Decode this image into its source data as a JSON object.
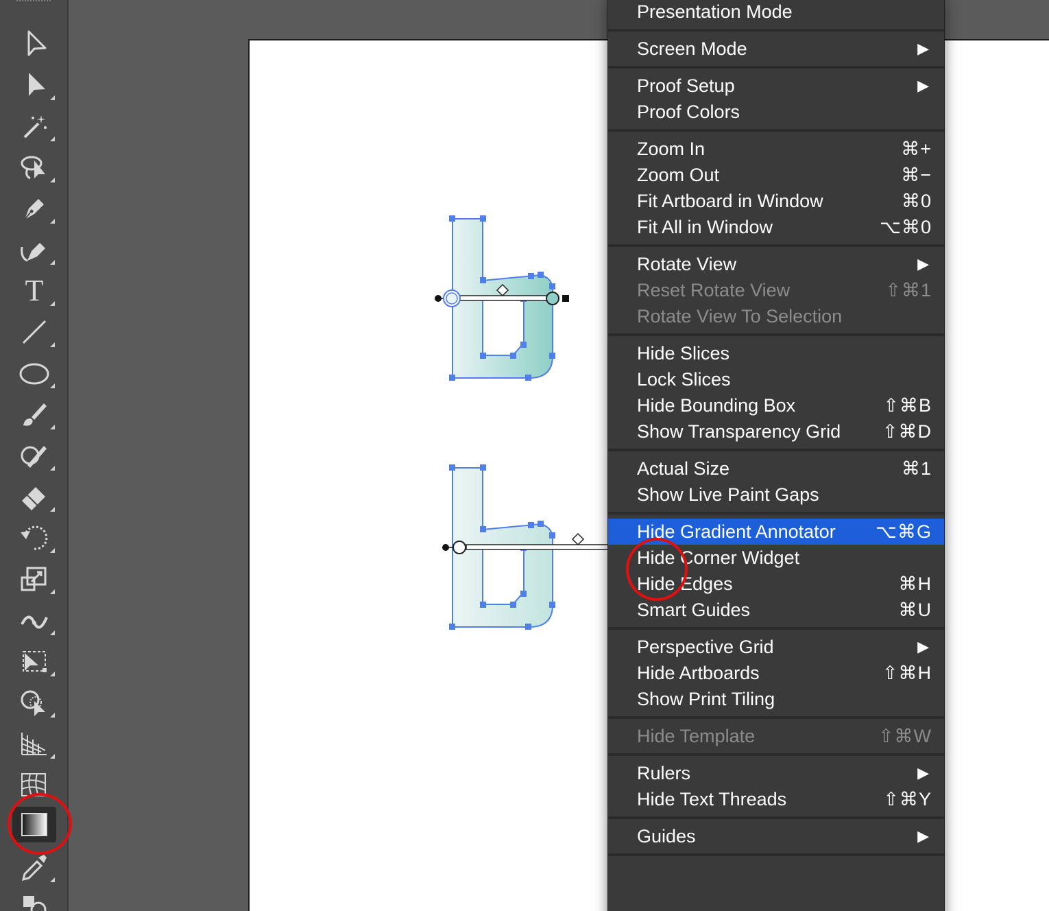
{
  "toolbar": {
    "tools": [
      {
        "name": "direct-selection-tool-icon"
      },
      {
        "name": "selection-tool-icon"
      },
      {
        "name": "magic-wand-tool-icon"
      },
      {
        "name": "lasso-tool-icon"
      },
      {
        "name": "pen-tool-icon"
      },
      {
        "name": "curvature-tool-icon"
      },
      {
        "name": "type-tool-icon",
        "glyph": "T"
      },
      {
        "name": "line-segment-tool-icon"
      },
      {
        "name": "ellipse-tool-icon"
      },
      {
        "name": "paintbrush-tool-icon"
      },
      {
        "name": "shaper-tool-icon"
      },
      {
        "name": "eraser-tool-icon"
      },
      {
        "name": "rotate-tool-icon"
      },
      {
        "name": "scale-tool-icon"
      },
      {
        "name": "width-tool-icon"
      },
      {
        "name": "free-transform-tool-icon"
      },
      {
        "name": "shape-builder-tool-icon"
      },
      {
        "name": "perspective-grid-tool-icon"
      },
      {
        "name": "mesh-tool-icon"
      },
      {
        "name": "gradient-tool-icon",
        "active": true
      },
      {
        "name": "eyedropper-tool-icon"
      },
      {
        "name": "blend-tool-icon"
      }
    ]
  },
  "menu": {
    "groups": [
      [
        {
          "label": "Presentation Mode"
        }
      ],
      [
        {
          "label": "Screen Mode",
          "submenu": true
        }
      ],
      [
        {
          "label": "Proof Setup",
          "submenu": true
        },
        {
          "label": "Proof Colors"
        }
      ],
      [
        {
          "label": "Zoom In",
          "shortcut": "⌘+"
        },
        {
          "label": "Zoom Out",
          "shortcut": "⌘−"
        },
        {
          "label": "Fit Artboard in Window",
          "shortcut": "⌘0"
        },
        {
          "label": "Fit All in Window",
          "shortcut": "⌥⌘0"
        }
      ],
      [
        {
          "label": "Rotate View",
          "submenu": true
        },
        {
          "label": "Reset Rotate View",
          "shortcut": "⇧⌘1",
          "disabled": true
        },
        {
          "label": "Rotate View To Selection",
          "disabled": true
        }
      ],
      [
        {
          "label": "Hide Slices"
        },
        {
          "label": "Lock Slices"
        },
        {
          "label": "Hide Bounding Box",
          "shortcut": "⇧⌘B"
        },
        {
          "label": "Show Transparency Grid",
          "shortcut": "⇧⌘D"
        }
      ],
      [
        {
          "label": "Actual Size",
          "shortcut": "⌘1"
        },
        {
          "label": "Show Live Paint Gaps"
        }
      ],
      [
        {
          "label": "Hide Gradient Annotator",
          "shortcut": "⌥⌘G",
          "highlighted": true
        },
        {
          "label": "Hide Corner Widget"
        },
        {
          "label": "Hide Edges",
          "shortcut": "⌘H"
        },
        {
          "label": "Smart Guides",
          "shortcut": "⌘U"
        }
      ],
      [
        {
          "label": "Perspective Grid",
          "submenu": true
        },
        {
          "label": "Hide Artboards",
          "shortcut": "⇧⌘H"
        },
        {
          "label": "Show Print Tiling"
        }
      ],
      [
        {
          "label": "Hide Template",
          "shortcut": "⇧⌘W",
          "disabled": true
        }
      ],
      [
        {
          "label": "Rulers",
          "submenu": true
        },
        {
          "label": "Hide Text Threads",
          "shortcut": "⇧⌘Y"
        }
      ],
      [
        {
          "label": "Guides",
          "submenu": true
        }
      ]
    ],
    "submenu_arrow": "▶"
  },
  "colors": {
    "highlight": "#1c5fd9",
    "annotation": "#e01010",
    "selection": "#4f7fe8",
    "gradient_start": "#e8f4f3",
    "gradient_end": "#8fcfc7"
  }
}
